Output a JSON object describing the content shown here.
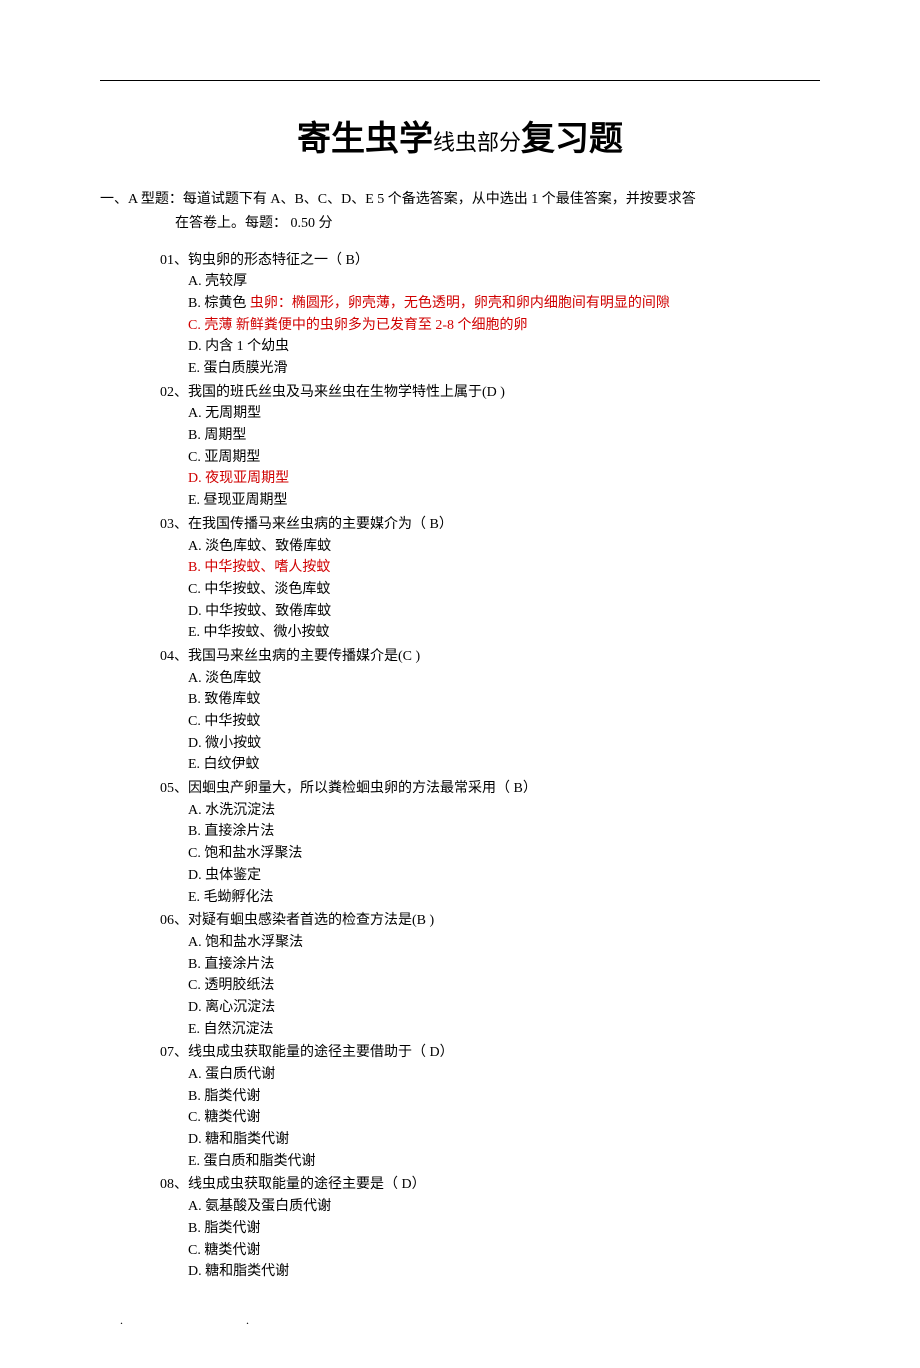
{
  "title": {
    "part1": "寄生虫学",
    "part2": "线虫部分",
    "part3": "复习题"
  },
  "section": {
    "label": "一、A 型题：",
    "intro_line1": "每道试题下有 A、B、C、D、E 5 个备选答案，从中选出 1 个最佳答案，并按要求答",
    "intro_line2": "在答卷上。每题：  0.50 分"
  },
  "questions": [
    {
      "num": "01、",
      "stem": "钩虫卵的形态特征之一（ B）",
      "options": [
        {
          "text": "A. 壳较厚"
        },
        {
          "text_prefix": "B. 棕黄色",
          "red_text": " 虫卵：椭圆形，卵壳薄，无色透明，卵壳和卵内细胞间有明显的间隙",
          "is_answer": false,
          "split": true
        },
        {
          "text_prefix": "C. 壳薄",
          "red_text": "          新鲜粪便中的虫卵多为已发育至 2-8 个细胞的卵",
          "is_answer": true,
          "split": true
        },
        {
          "text": "D. 内含 1 个幼虫"
        },
        {
          "text": "E. 蛋白质膜光滑"
        }
      ]
    },
    {
      "num": "02、",
      "stem": "我国的班氏丝虫及马来丝虫在生物学特性上属于(D  )",
      "options": [
        {
          "text": "A. 无周期型"
        },
        {
          "text": "B. 周期型"
        },
        {
          "text": "C. 亚周期型"
        },
        {
          "text": "D. 夜现亚周期型",
          "is_answer": true
        },
        {
          "text": "E. 昼现亚周期型"
        }
      ]
    },
    {
      "num": "03、",
      "stem": "在我国传播马来丝虫病的主要媒介为（ B）",
      "options": [
        {
          "text": "A. 淡色库蚊、致倦库蚊"
        },
        {
          "text": "B. 中华按蚊、嗜人按蚊",
          "is_answer": true
        },
        {
          "text": "C. 中华按蚊、淡色库蚊"
        },
        {
          "text": "D. 中华按蚊、致倦库蚊"
        },
        {
          "text": "E. 中华按蚊、微小按蚊"
        }
      ]
    },
    {
      "num": "04、",
      "stem": "我国马来丝虫病的主要传播媒介是(C  )",
      "options": [
        {
          "text": "A. 淡色库蚊"
        },
        {
          "text": "B. 致倦库蚊"
        },
        {
          "text": "C. 中华按蚊"
        },
        {
          "text": "D. 微小按蚊"
        },
        {
          "text": "E. 白纹伊蚊"
        }
      ]
    },
    {
      "num": "05、",
      "stem": "因蛔虫产卵量大，所以粪检蛔虫卵的方法最常采用（ B）",
      "options": [
        {
          "text": "A. 水洗沉淀法"
        },
        {
          "text": "B. 直接涂片法"
        },
        {
          "text": "C. 饱和盐水浮聚法"
        },
        {
          "text": "D. 虫体鉴定"
        },
        {
          "text": "E. 毛蚴孵化法"
        }
      ]
    },
    {
      "num": "06、",
      "stem": "对疑有蛔虫感染者首选的检查方法是(B  )",
      "options": [
        {
          "text": "A. 饱和盐水浮聚法"
        },
        {
          "text": "B. 直接涂片法"
        },
        {
          "text": "C. 透明胶纸法"
        },
        {
          "text": "D. 离心沉淀法"
        },
        {
          "text": "E. 自然沉淀法"
        }
      ]
    },
    {
      "num": "07、",
      "stem": "线虫成虫获取能量的途径主要借助于（ D）",
      "options": [
        {
          "text": "A. 蛋白质代谢"
        },
        {
          "text": "B. 脂类代谢"
        },
        {
          "text": "C. 糖类代谢"
        },
        {
          "text": "D. 糖和脂类代谢"
        },
        {
          "text": "E. 蛋白质和脂类代谢"
        }
      ]
    },
    {
      "num": "08、",
      "stem": "线虫成虫获取能量的途径主要是（ D）",
      "options": [
        {
          "text": "A. 氨基酸及蛋白质代谢"
        },
        {
          "text": "B. 脂类代谢"
        },
        {
          "text": "C. 糖类代谢"
        },
        {
          "text": "D. 糖和脂类代谢"
        }
      ]
    }
  ],
  "footer": ". ."
}
